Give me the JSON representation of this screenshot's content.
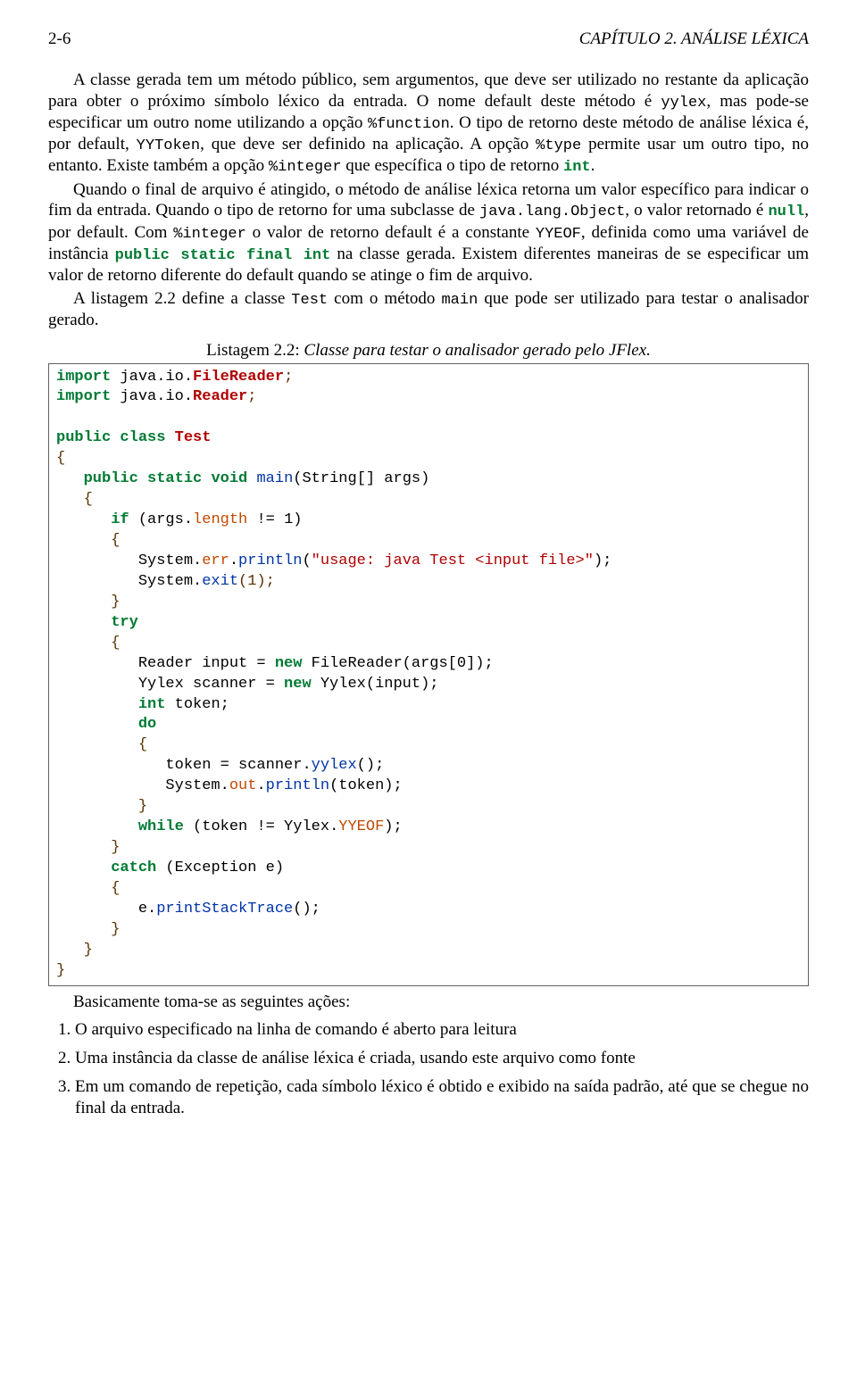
{
  "header": {
    "page_num": "2-6",
    "chapter": "CAPÍTULO 2. ANÁLISE LÉXICA"
  },
  "para1": {
    "t1": "A classe gerada tem um método público, sem argumentos, que deve ser utilizado no restante da aplicação para obter o próximo símbolo léxico da entrada. O nome default deste método é ",
    "c1": "yylex",
    "t2": ", mas pode-se especificar um outro nome utilizando a opção ",
    "c2": "%function",
    "t3": ". O tipo de retorno deste método de análise léxica é, por default, ",
    "c3": "YYToken",
    "t4": ", que deve ser definido na aplicação. A opção ",
    "c4": "%type",
    "t5": " permite usar um outro tipo, no entanto. Existe também a opção ",
    "c5": "%integer",
    "t6": " que específica o tipo de retorno ",
    "kw1": "int",
    "t7": "."
  },
  "para2": {
    "t1": "Quando o final de arquivo é atingido, o método de análise léxica retorna um valor específico para indicar o fim da entrada. Quando o tipo de retorno for uma subclasse de ",
    "c1": "java.lang.Object",
    "t2": ", o valor retornado é ",
    "kw1": "null",
    "t3": ", por default. Com ",
    "c2": "%integer",
    "t4": " o valor de retorno default é a constante ",
    "c3": "YYEOF",
    "t5": ", definida como uma variável de instância ",
    "kw2": "public static final int",
    "t6": " na classe gerada. Existem diferentes maneiras de se especificar um valor de retorno diferente do default quando se atinge o fim de arquivo."
  },
  "para3": {
    "t1": "A listagem 2.2 define a classe ",
    "c1": "Test",
    "t2": " com o método ",
    "c2": "main",
    "t3": " que pode ser utilizado para testar o analisador gerado."
  },
  "caption": {
    "label": "Listagem 2.2:",
    "text": " Classe para testar o analisador gerado pelo JFlex."
  },
  "code": {
    "kw_import": "import",
    "pkg1": " java.io.",
    "cls1": "FileReader",
    "semi": ";",
    "pkg2": " java.io.",
    "cls2": "Reader",
    "kw_public": "public",
    "kw_class": "class",
    "cls_test": "Test",
    "brace_o": "{",
    "brace_c": "}",
    "kw_static": "static",
    "kw_void": "void",
    "fn_main": "main",
    "sig_main": "(String[] args)",
    "kw_if": "if",
    "cond_if": " (args.",
    "mbr_length": "length",
    "cond_if2": " != 1)",
    "sysout_err1": "         System.",
    "mbr_err": "err",
    "dot": ".",
    "fn_println": "println",
    "str_usage_open": "(",
    "str_usage": "\"usage: java Test <input file>\"",
    "str_usage_close": ");",
    "sysexit": "         System.",
    "fn_exit": "exit",
    "exit_arg": "(1);",
    "kw_try": "try",
    "ln_reader": "         Reader input = ",
    "kw_new": "new",
    "reader_rest": " FileReader(args[0]);",
    "ln_scanner": "         Yylex scanner = ",
    "scanner_rest": " Yylex(input);",
    "kw_int": "int",
    "tok_decl": " token;",
    "kw_do": "do",
    "ln_tok": "            token = scanner.",
    "fn_yylex": "yylex",
    "yylex_rest": "();",
    "ln_sysout": "            System.",
    "mbr_out": "out",
    "println_tok": "(token);",
    "kw_while": "while",
    "while_cond1": " (token != Yylex.",
    "mbr_yyeof": "YYEOF",
    "while_cond2": ");",
    "kw_catch": "catch",
    "catch_sig": " (Exception e)",
    "ln_pst": "         e.",
    "fn_pst": "printStackTrace",
    "pst_rest": "();"
  },
  "para4": "Basicamente toma-se as seguintes ações:",
  "steps": [
    "O arquivo especificado na linha de comando é aberto para leitura",
    "Uma instância da classe de análise léxica é criada, usando este arquivo como fonte",
    "Em um comando de repetição, cada símbolo léxico é obtido e exibido na saída padrão, até que se chegue no final da entrada."
  ]
}
